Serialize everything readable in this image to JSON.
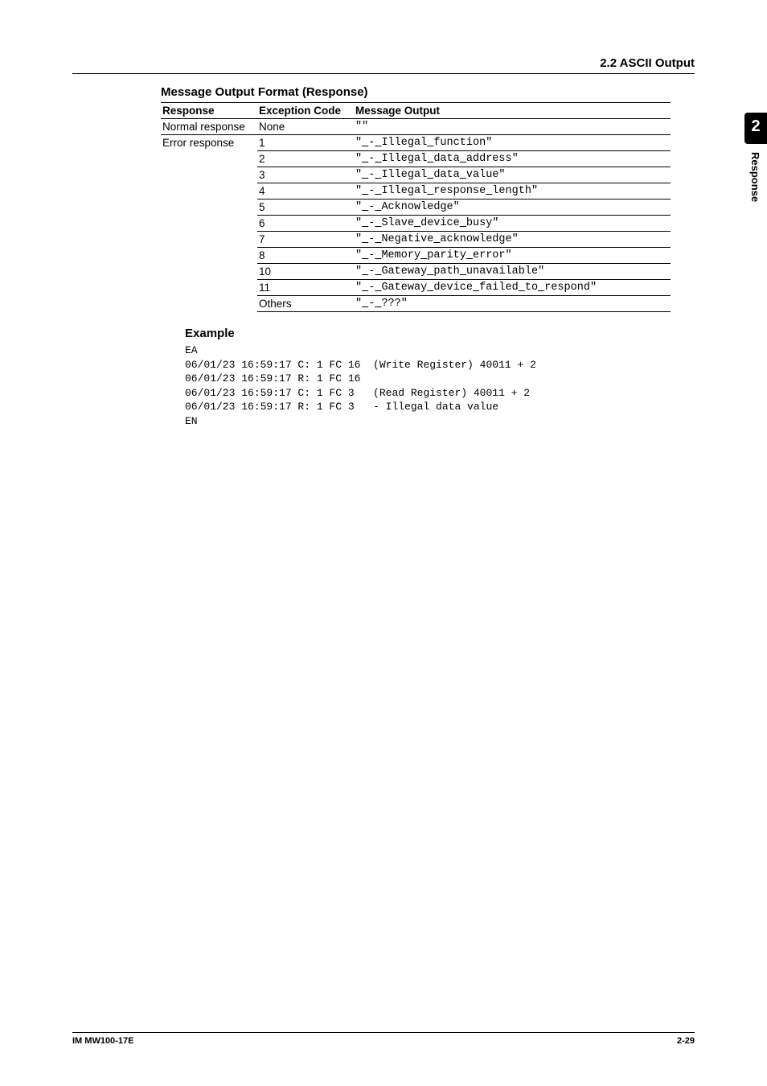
{
  "header": {
    "section": "2.2  ASCII Output"
  },
  "sidetab": {
    "number": "2",
    "label": "Response"
  },
  "table": {
    "title": "Message Output Format (Response)",
    "columns": {
      "c1": "Response",
      "c2": "Exception Code",
      "c3": "Message Output"
    },
    "rows": [
      {
        "resp": "Normal response",
        "exc": "None",
        "msg": "\"\"",
        "respspan": 1,
        "sep": true
      },
      {
        "resp": "Error response",
        "exc": "1",
        "msg": "\"␣-␣Illegal␣function\"",
        "respspan": 12,
        "sep": true
      },
      {
        "resp": "",
        "exc": "2",
        "msg": "\"␣-␣Illegal␣data␣address\"",
        "sep": true
      },
      {
        "resp": "",
        "exc": "3",
        "msg": "\"␣-␣Illegal␣data␣value\"",
        "sep": true
      },
      {
        "resp": "",
        "exc": "4",
        "msg": "\"␣-␣Illegal␣response␣length\"",
        "sep": true
      },
      {
        "resp": "",
        "exc": "5",
        "msg": "\"␣-␣Acknowledge\"",
        "sep": true
      },
      {
        "resp": "",
        "exc": "6",
        "msg": "\"␣-␣Slave␣device␣busy\"",
        "sep": true
      },
      {
        "resp": "",
        "exc": "7",
        "msg": "\"␣-␣Negative␣acknowledge\"",
        "sep": true
      },
      {
        "resp": "",
        "exc": "8",
        "msg": "\"␣-␣Memory␣parity␣error\"",
        "sep": true
      },
      {
        "resp": "",
        "exc": "10",
        "msg": "\"␣-␣Gateway␣path␣unavailable\"",
        "sep": true
      },
      {
        "resp": "",
        "exc": "11",
        "msg": "\"␣-␣Gateway␣device␣failed␣to␣respond\"",
        "sep": true
      },
      {
        "resp": "",
        "exc": "Others",
        "msg": "\"␣-␣???\"",
        "sep": false
      }
    ]
  },
  "example": {
    "title": "Example",
    "code": "EA\n06/01/23 16:59:17 C: 1 FC 16  (Write Register) 40011 + 2\n06/01/23 16:59:17 R: 1 FC 16\n06/01/23 16:59:17 C: 1 FC 3   (Read Register) 40011 + 2\n06/01/23 16:59:17 R: 1 FC 3   - Illegal data value\nEN"
  },
  "footer": {
    "left": "IM MW100-17E",
    "right": "2-29"
  }
}
